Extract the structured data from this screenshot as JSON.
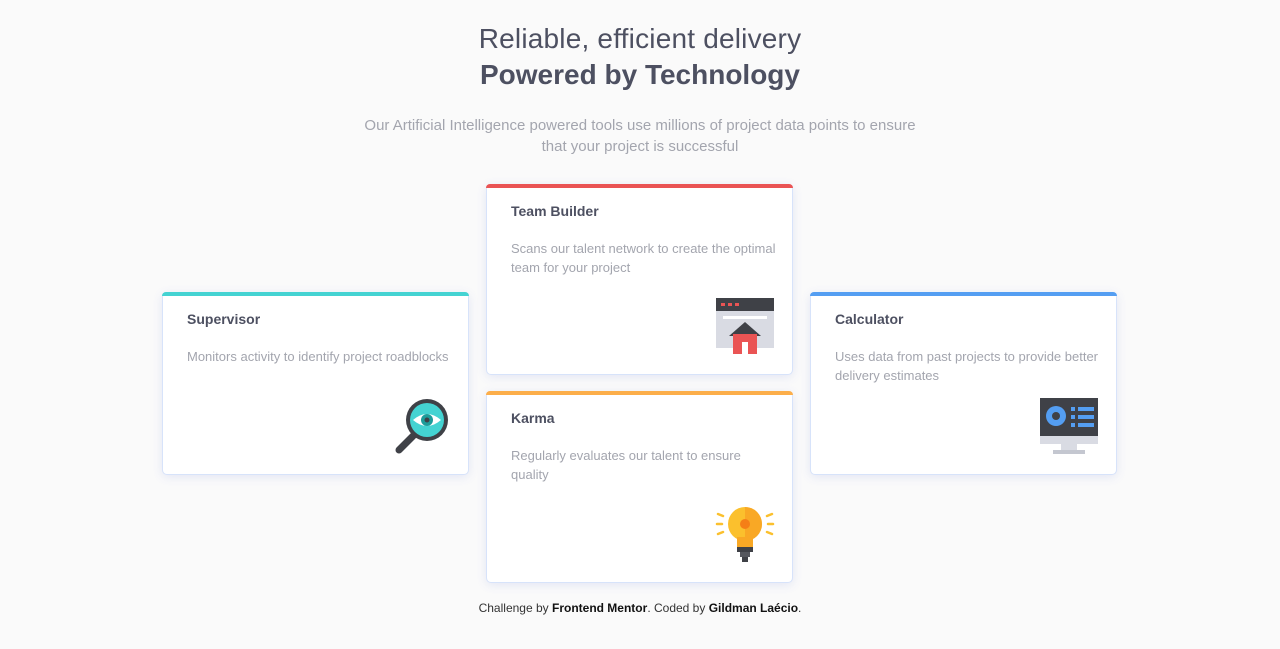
{
  "header": {
    "subtitle": "Reliable, efficient delivery",
    "title": "Powered by Technology",
    "intro": "Our Artificial Intelligence powered tools use millions of project data points to ensure that your project is successful"
  },
  "cards": {
    "supervisor": {
      "title": "Supervisor",
      "description": "Monitors activity to identify project roadblocks",
      "accent": "#44d3d2",
      "icon": "magnifier-eye-icon"
    },
    "team_builder": {
      "title": "Team Builder",
      "description": "Scans our talent network to create the optimal team for your project",
      "accent": "#ea5454",
      "icon": "browser-house-icon"
    },
    "karma": {
      "title": "Karma",
      "description": "Regularly evaluates our talent to ensure quality",
      "accent": "#fcae4a",
      "icon": "lightbulb-icon"
    },
    "calculator": {
      "title": "Calculator",
      "description": "Uses data from past projects to provide better delivery estimates",
      "accent": "#549ef2",
      "icon": "monitor-chart-icon"
    }
  },
  "footer": {
    "prefix": "Challenge by ",
    "brand": "Frontend Mentor",
    "middle": ". Coded by ",
    "author": "Gildman Laécio",
    "suffix": "."
  }
}
